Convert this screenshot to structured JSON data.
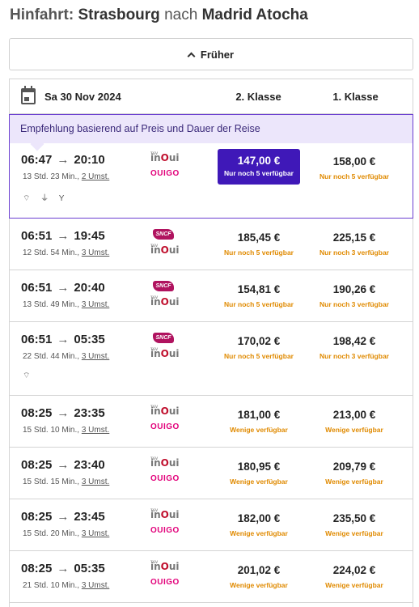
{
  "header": {
    "lead": "Hinfahrt:",
    "from": "Strasbourg",
    "connector": "nach",
    "to": "Madrid Atocha"
  },
  "earlier_button": {
    "label": "Früher",
    "icon": "chevron-up-icon"
  },
  "table_header": {
    "icon": "calendar-icon",
    "date": "Sa 30 Nov 2024",
    "class2": "2. Klasse",
    "class1": "1. Klasse"
  },
  "recommendation": {
    "text": "Empfehlung basierend auf Preis und Dauer der Reise"
  },
  "colors": {
    "accent": "#3f18b8",
    "availability": "#e08a00",
    "recommendation_bg": "#ece6fb",
    "ouigo": "#e2007a",
    "sncf": "#b0135f"
  },
  "journeys": [
    {
      "dep": "06:47",
      "arr": "20:10",
      "duration": "13 Std. 23 Min.,",
      "changes": "2 Umst.",
      "operators": [
        "inoui",
        "ouigo"
      ],
      "amenities": [
        "wifi-icon",
        "plug-icon",
        "bar-icon"
      ],
      "amenity_glyphs": "⌔ ⏚ Y",
      "price2": "147,00 €",
      "avail2": "Nur noch 5 verfügbar",
      "price1": "158,00 €",
      "avail1": "Nur noch 5 verfügbar",
      "highlighted": true
    },
    {
      "dep": "06:51",
      "arr": "19:45",
      "duration": "12 Std. 54 Min.,",
      "changes": "3 Umst.",
      "operators": [
        "sncf",
        "inoui"
      ],
      "price2": "185,45 €",
      "avail2": "Nur noch 5 verfügbar",
      "price1": "225,15 €",
      "avail1": "Nur noch 3 verfügbar"
    },
    {
      "dep": "06:51",
      "arr": "20:40",
      "duration": "13 Std. 49 Min.,",
      "changes": "3 Umst.",
      "operators": [
        "sncf",
        "inoui"
      ],
      "price2": "154,81 €",
      "avail2": "Nur noch 5 verfügbar",
      "price1": "190,26 €",
      "avail1": "Nur noch 3 verfügbar"
    },
    {
      "dep": "06:51",
      "arr": "05:35",
      "duration": "22 Std. 44 Min.,",
      "changes": "3 Umst.",
      "operators": [
        "sncf",
        "inoui"
      ],
      "amenities": [
        "wifi-icon"
      ],
      "amenity_glyphs": "⌔",
      "price2": "170,02 €",
      "avail2": "Nur noch 5 verfügbar",
      "price1": "198,42 €",
      "avail1": "Nur noch 3 verfügbar"
    },
    {
      "dep": "08:25",
      "arr": "23:35",
      "duration": "15 Std. 10 Min.,",
      "changes": "3 Umst.",
      "operators": [
        "inoui",
        "ouigo"
      ],
      "price2": "181,00 €",
      "avail2": "Wenige verfügbar",
      "price1": "213,00 €",
      "avail1": "Wenige verfügbar"
    },
    {
      "dep": "08:25",
      "arr": "23:40",
      "duration": "15 Std. 15 Min.,",
      "changes": "3 Umst.",
      "operators": [
        "inoui",
        "ouigo"
      ],
      "price2": "180,95 €",
      "avail2": "Wenige verfügbar",
      "price1": "209,79 €",
      "avail1": "Wenige verfügbar"
    },
    {
      "dep": "08:25",
      "arr": "23:45",
      "duration": "15 Std. 20 Min.,",
      "changes": "3 Umst.",
      "operators": [
        "inoui",
        "ouigo"
      ],
      "price2": "182,00 €",
      "avail2": "Wenige verfügbar",
      "price1": "235,50 €",
      "avail1": "Wenige verfügbar"
    },
    {
      "dep": "08:25",
      "arr": "05:35",
      "duration": "21 Std. 10 Min.,",
      "changes": "3 Umst.",
      "operators": [
        "inoui",
        "ouigo"
      ],
      "price2": "201,02 €",
      "avail2": "Wenige verfügbar",
      "price1": "224,02 €",
      "avail1": "Wenige verfügbar"
    }
  ],
  "logo_text": {
    "inoui_prefix": "in",
    "inoui_o": "O",
    "inoui_suffix": "ui",
    "ouigo": "OUIGO",
    "sncf": "SNCF"
  }
}
